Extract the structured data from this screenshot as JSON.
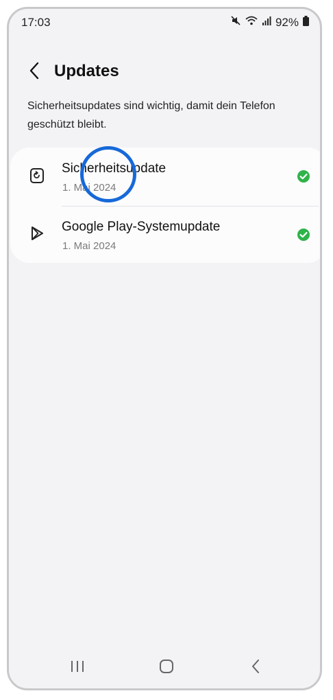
{
  "status_bar": {
    "time": "17:03",
    "battery_percent": "92%",
    "icons": [
      "mute-icon",
      "wifi-icon",
      "signal-icon",
      "battery-icon"
    ]
  },
  "header": {
    "title": "Updates",
    "back_icon": "chevron-left-icon"
  },
  "description": "Sicherheitsupdates sind wichtig, damit dein Telefon geschützt bleibt.",
  "updates": [
    {
      "title": "Sicherheitsupdate",
      "date": "1. Mai 2024",
      "icon": "security-update-icon",
      "status": "check-circle-icon"
    },
    {
      "title": "Google Play-Systemupdate",
      "date": "1. Mai 2024",
      "icon": "google-play-icon",
      "status": "check-circle-icon"
    }
  ],
  "nav_bar": {
    "icons": [
      "recents-icon",
      "home-icon",
      "back-icon"
    ]
  },
  "colors": {
    "background": "#f3f3f6",
    "card": "#fcfcfd",
    "check_green": "#2fb34a",
    "highlight_ring": "#1769d8"
  }
}
